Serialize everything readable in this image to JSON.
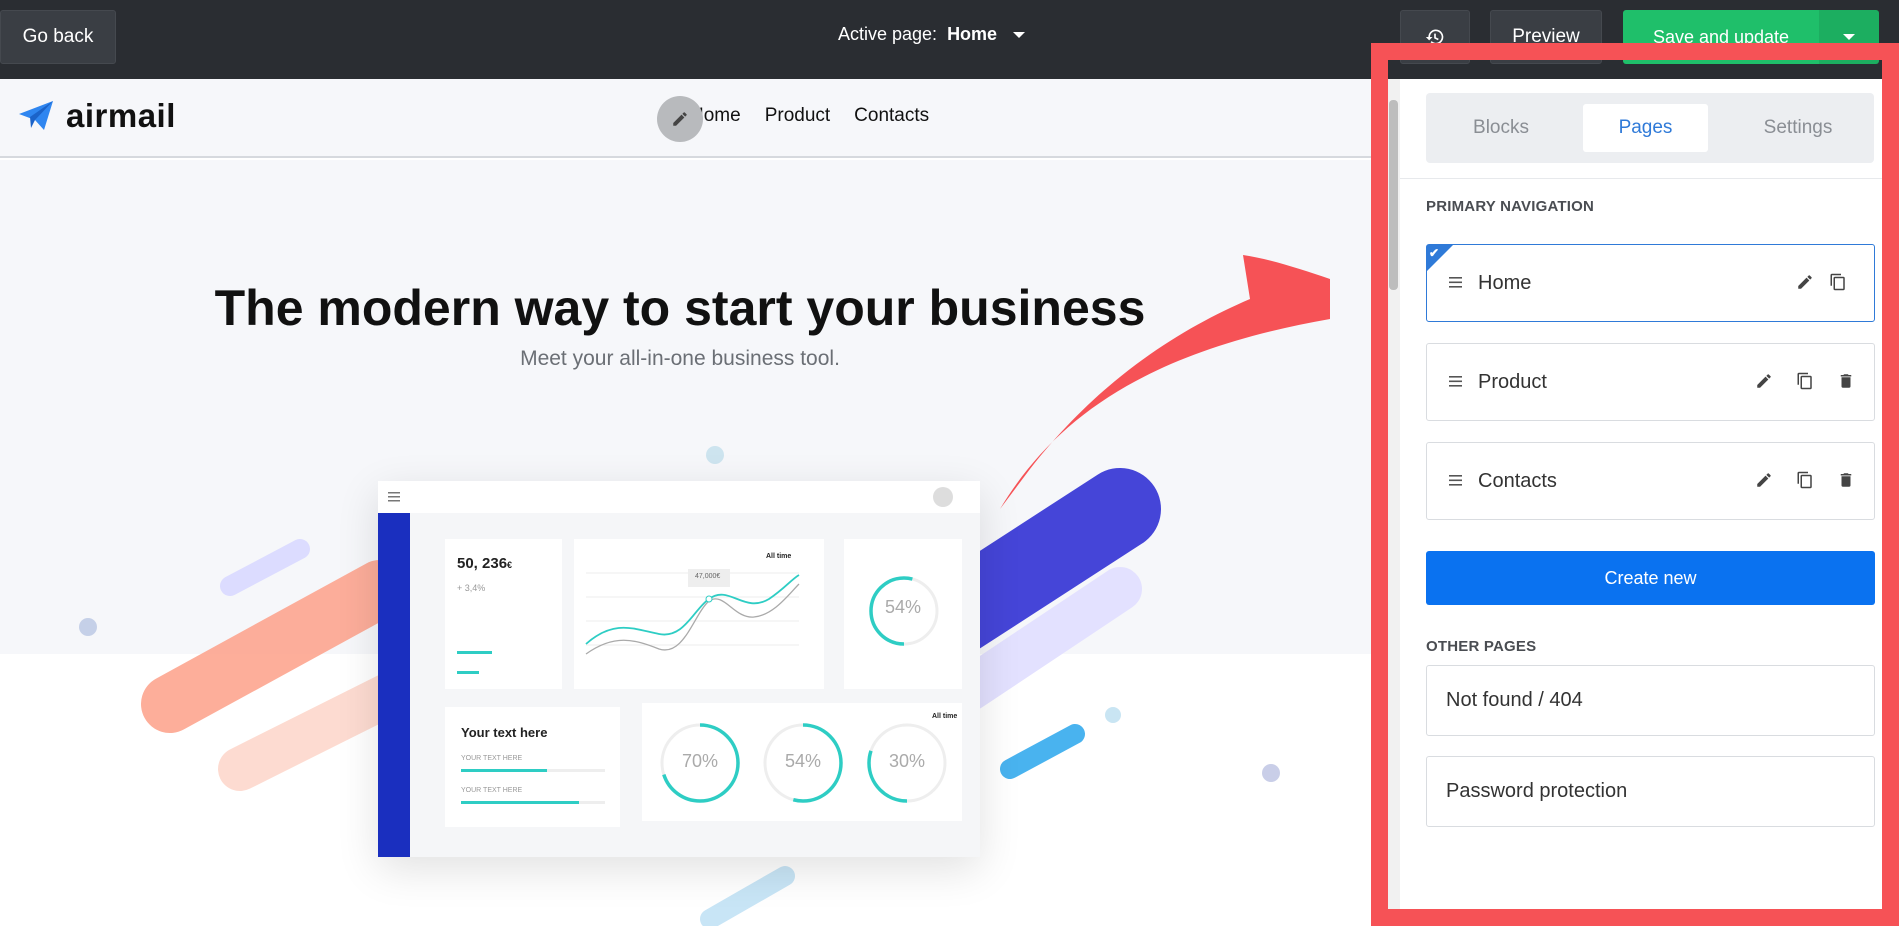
{
  "topbar": {
    "go_back_label": "Go back",
    "active_page_label": "Active page:",
    "active_page_value": "Home",
    "history_icon": "history-icon",
    "preview_label": "Preview",
    "save_label": "Save and update"
  },
  "site": {
    "logo_text": "airmail",
    "nav_links": [
      "Home",
      "Product",
      "Contacts"
    ],
    "hero_title": "The modern way to start your business",
    "hero_subtitle": "Meet your all-in-one business tool.",
    "dashboard": {
      "stat_value": "50, 236",
      "stat_currency": "€",
      "stat_change": "+ 3,4%",
      "tooltip_value": "47,000€",
      "filter_label": "All time",
      "ring_top_value": "54%",
      "card_title": "Your text here",
      "progress_label_1": "YOUR TEXT HERE",
      "progress_label_2": "YOUR TEXT HERE",
      "ring_values": [
        "70%",
        "54%",
        "30%"
      ]
    }
  },
  "panel": {
    "tabs": [
      "Blocks",
      "Pages",
      "Settings"
    ],
    "active_tab": "Pages",
    "primary_nav_title": "PRIMARY NAVIGATION",
    "primary_pages": [
      {
        "label": "Home",
        "active": true
      },
      {
        "label": "Product",
        "active": false
      },
      {
        "label": "Contacts",
        "active": false
      }
    ],
    "create_label": "Create new",
    "other_title": "OTHER PAGES",
    "other_pages": [
      "Not found / 404",
      "Password protection"
    ]
  },
  "colors": {
    "accent": "#0a72f0",
    "save_green": "#1fbf6a",
    "highlight_red": "#f65256",
    "dashboard_blue": "#1a2fbf",
    "teal": "#2ecdc4"
  }
}
